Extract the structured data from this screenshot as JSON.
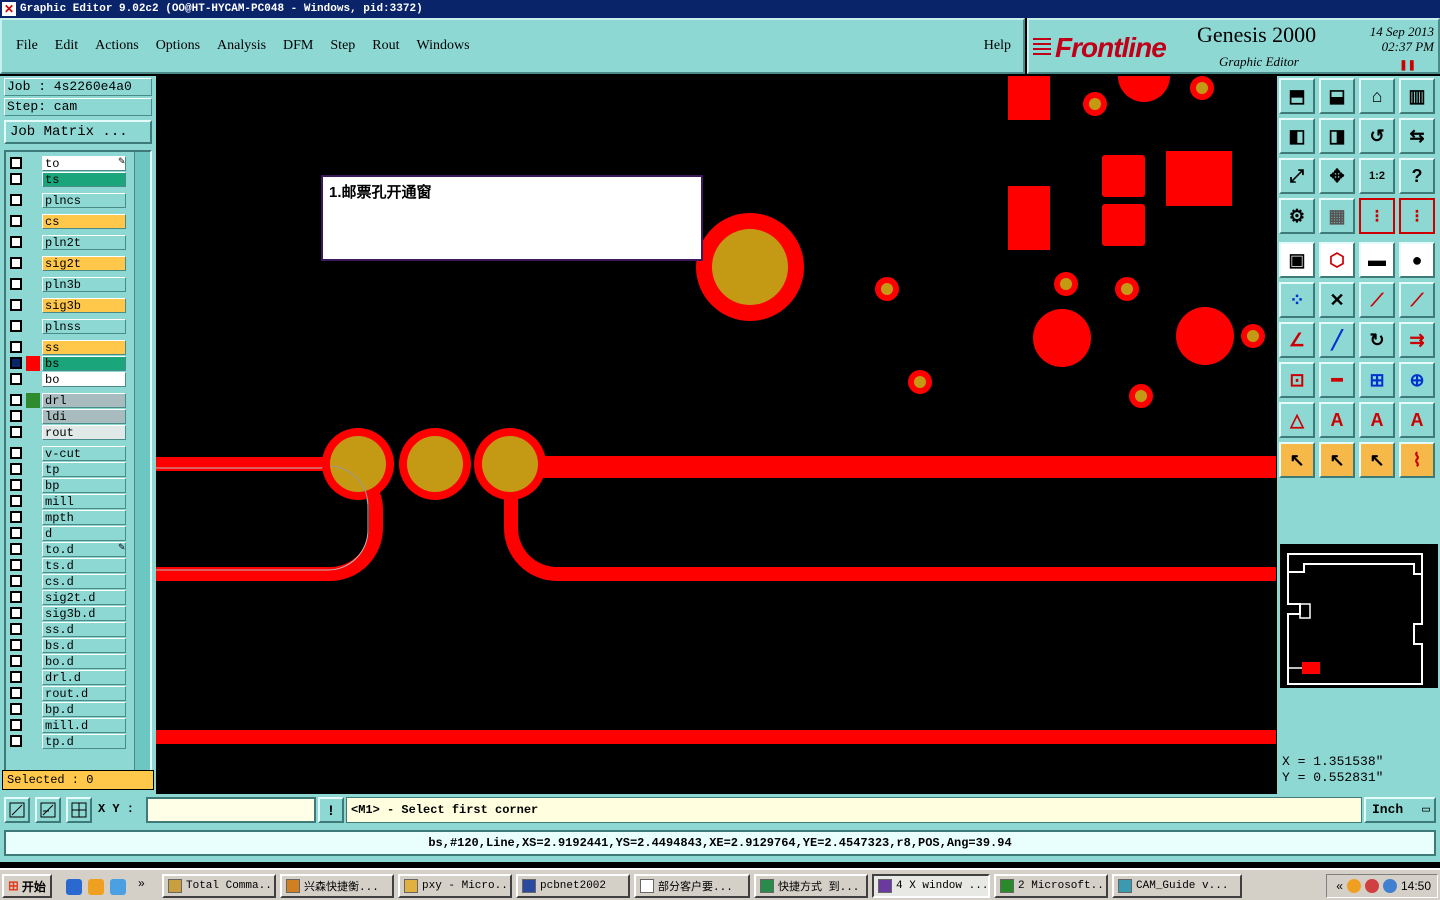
{
  "window": {
    "title": "Graphic Editor 9.02c2 (OO@HT-HYCAM-PC048 - Windows, pid:3372)"
  },
  "menu": {
    "items": [
      "File",
      "Edit",
      "Actions",
      "Options",
      "Analysis",
      "DFM",
      "Step",
      "Rout",
      "Windows"
    ],
    "help": "Help"
  },
  "brand": {
    "logo": "Frontline",
    "product": "Genesis 2000",
    "subtitle": "Graphic Editor",
    "date": "14 Sep 2013",
    "time": "02:37 PM",
    "pause_icon": "pause-icon"
  },
  "job": {
    "job_label": "Job : 4s2260e4a0",
    "step_label": "Step: cam",
    "matrix_button": "Job Matrix ..."
  },
  "layers": [
    {
      "name": "to",
      "color": "#ffffff",
      "swatch": "",
      "pen": true
    },
    {
      "name": "ts",
      "color": "#1aa57a",
      "swatch": ""
    },
    {
      "name": "plncs",
      "color": "#8ed8d4",
      "swatch": ""
    },
    {
      "name": "cs",
      "color": "#ffc84a",
      "swatch": ""
    },
    {
      "name": "pln2t",
      "color": "#8ed8d4",
      "swatch": ""
    },
    {
      "name": "sig2t",
      "color": "#ffc84a",
      "swatch": ""
    },
    {
      "name": "pln3b",
      "color": "#8ed8d4",
      "swatch": ""
    },
    {
      "name": "sig3b",
      "color": "#ffc84a",
      "swatch": ""
    },
    {
      "name": "plnss",
      "color": "#8ed8d4",
      "swatch": ""
    },
    {
      "name": "ss",
      "color": "#ffc84a",
      "swatch": ""
    },
    {
      "name": "bs",
      "color": "#1aa57a",
      "swatch": "#ff0000",
      "active": true
    },
    {
      "name": "bo",
      "color": "#ffffff",
      "swatch": ""
    },
    {
      "name": "drl",
      "color": "#a8bcc0",
      "swatch": "#2e8b2e"
    },
    {
      "name": "ldi",
      "color": "#a8bcc0",
      "swatch": ""
    },
    {
      "name": "rout",
      "color": "#e0e8e8",
      "swatch": ""
    },
    {
      "name": "v-cut",
      "color": "#8ed8d4",
      "swatch": ""
    },
    {
      "name": "tp",
      "color": "#8ed8d4",
      "swatch": ""
    },
    {
      "name": "bp",
      "color": "#8ed8d4",
      "swatch": ""
    },
    {
      "name": "mill",
      "color": "#8ed8d4",
      "swatch": ""
    },
    {
      "name": "mpth",
      "color": "#8ed8d4",
      "swatch": ""
    },
    {
      "name": "d",
      "color": "#8ed8d4",
      "swatch": ""
    },
    {
      "name": "to.d",
      "color": "#8ed8d4",
      "swatch": "",
      "pen": true
    },
    {
      "name": "ts.d",
      "color": "#8ed8d4",
      "swatch": ""
    },
    {
      "name": "cs.d",
      "color": "#8ed8d4",
      "swatch": ""
    },
    {
      "name": "sig2t.d",
      "color": "#8ed8d4",
      "swatch": ""
    },
    {
      "name": "sig3b.d",
      "color": "#8ed8d4",
      "swatch": ""
    },
    {
      "name": "ss.d",
      "color": "#8ed8d4",
      "swatch": ""
    },
    {
      "name": "bs.d",
      "color": "#8ed8d4",
      "swatch": ""
    },
    {
      "name": "bo.d",
      "color": "#8ed8d4",
      "swatch": ""
    },
    {
      "name": "drl.d",
      "color": "#8ed8d4",
      "swatch": ""
    },
    {
      "name": "rout.d",
      "color": "#8ed8d4",
      "swatch": ""
    },
    {
      "name": "bp.d",
      "color": "#8ed8d4",
      "swatch": ""
    },
    {
      "name": "mill.d",
      "color": "#8ed8d4",
      "swatch": ""
    },
    {
      "name": "tp.d",
      "color": "#8ed8d4",
      "swatch": ""
    }
  ],
  "selected": "Selected : 0",
  "note": "1.邮票孔开通窗",
  "coords": {
    "x": "X = 1.351538\"",
    "y": "Y = 0.552831\""
  },
  "command": {
    "xy_label": "X Y :",
    "xy_value": "",
    "prompt": "<M1> - Select first corner",
    "units": "Inch"
  },
  "status": "bs,#120,Line,XS=2.9192441,YS=2.4494843,XE=2.9129764,YE=2.4547323,r8,POS,Ang=39.94",
  "taskbar": {
    "start": "开始",
    "tasks": [
      "Total Comma...",
      "兴森快捷衡...",
      "pxy - Micro...",
      "pcbnet2002",
      "部分客户要...",
      "快捷方式 到...",
      "4 X window ...",
      "2 Microsoft...",
      "CAM_Guide v..."
    ],
    "clock": "14:50"
  },
  "colors": {
    "copper": "#ff0000",
    "pad": "#c49a14",
    "panel": "#8ed8d4",
    "selected": "#ffc84a"
  }
}
